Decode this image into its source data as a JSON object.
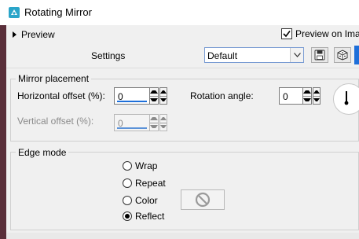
{
  "window": {
    "title": "Rotating Mirror",
    "icon": "app-icon"
  },
  "preview": {
    "toggle_label": "Preview",
    "checkbox_label": "Preview on Imag",
    "checked": true
  },
  "settings": {
    "label": "Settings",
    "preset_value": "Default",
    "save_icon": "floppy-disk-icon",
    "random_icon": "dice-icon"
  },
  "mirror_placement": {
    "legend": "Mirror placement",
    "horizontal_label": "Horizontal offset (%):",
    "horizontal_value": "0",
    "vertical_label": "Vertical offset (%):",
    "vertical_value": "0",
    "vertical_disabled": true,
    "rotation_label": "Rotation angle:",
    "rotation_value": "0"
  },
  "edge_mode": {
    "legend": "Edge mode",
    "options": [
      {
        "label": "Wrap",
        "selected": false
      },
      {
        "label": "Repeat",
        "selected": false
      },
      {
        "label": "Color",
        "selected": false
      },
      {
        "label": "Reflect",
        "selected": true
      }
    ],
    "color_icon": "no-color-icon"
  },
  "colors": {
    "accent": "#1e6fd9",
    "background": "#f0f0f0",
    "app_icon": "#2aa5c9"
  }
}
